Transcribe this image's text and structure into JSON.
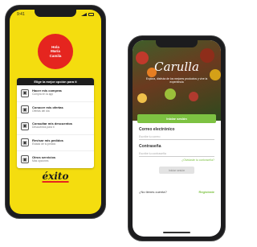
{
  "exito": {
    "time": "9:41",
    "welcome": [
      "Hola",
      "María",
      "Camila"
    ],
    "card_header": "Elige la mejor opción para ti",
    "options": [
      {
        "title": "Hacer mis compras",
        "sub": "Compra en la app",
        "icon": "cart-icon"
      },
      {
        "title": "Conocer mis ofertas",
        "sub": "Ofertas del día",
        "icon": "tag-icon"
      },
      {
        "title": "Consultar mis descuentos",
        "sub": "Descuentos para ti",
        "icon": "percent-icon"
      },
      {
        "title": "Revisar mis pedidos",
        "sub": "Estado de tu pedido",
        "icon": "box-icon"
      },
      {
        "title": "Otros servicios",
        "sub": "Más opciones",
        "icon": "grid-icon"
      }
    ],
    "logo": "éxito",
    "colors": {
      "bg": "#f4dd0f",
      "accent": "#e5251f"
    }
  },
  "carulla": {
    "logo": "Carulla",
    "tagline": "Explora, disfruta de los mejores productos y vive la experiencia",
    "primary_button": "Iniciar sesión",
    "email_label": "Correo electrónico",
    "email_placeholder": "Escribe tu correo",
    "password_label": "Contraseña",
    "password_placeholder": "Escribe tu contraseña",
    "forgot": "¿Olvidaste tu contraseña?",
    "submit": "Iniciar sesión",
    "signup_question": "¿No tienes cuenta?",
    "signup_link": "Regístrate",
    "colors": {
      "accent": "#7dc242"
    }
  }
}
